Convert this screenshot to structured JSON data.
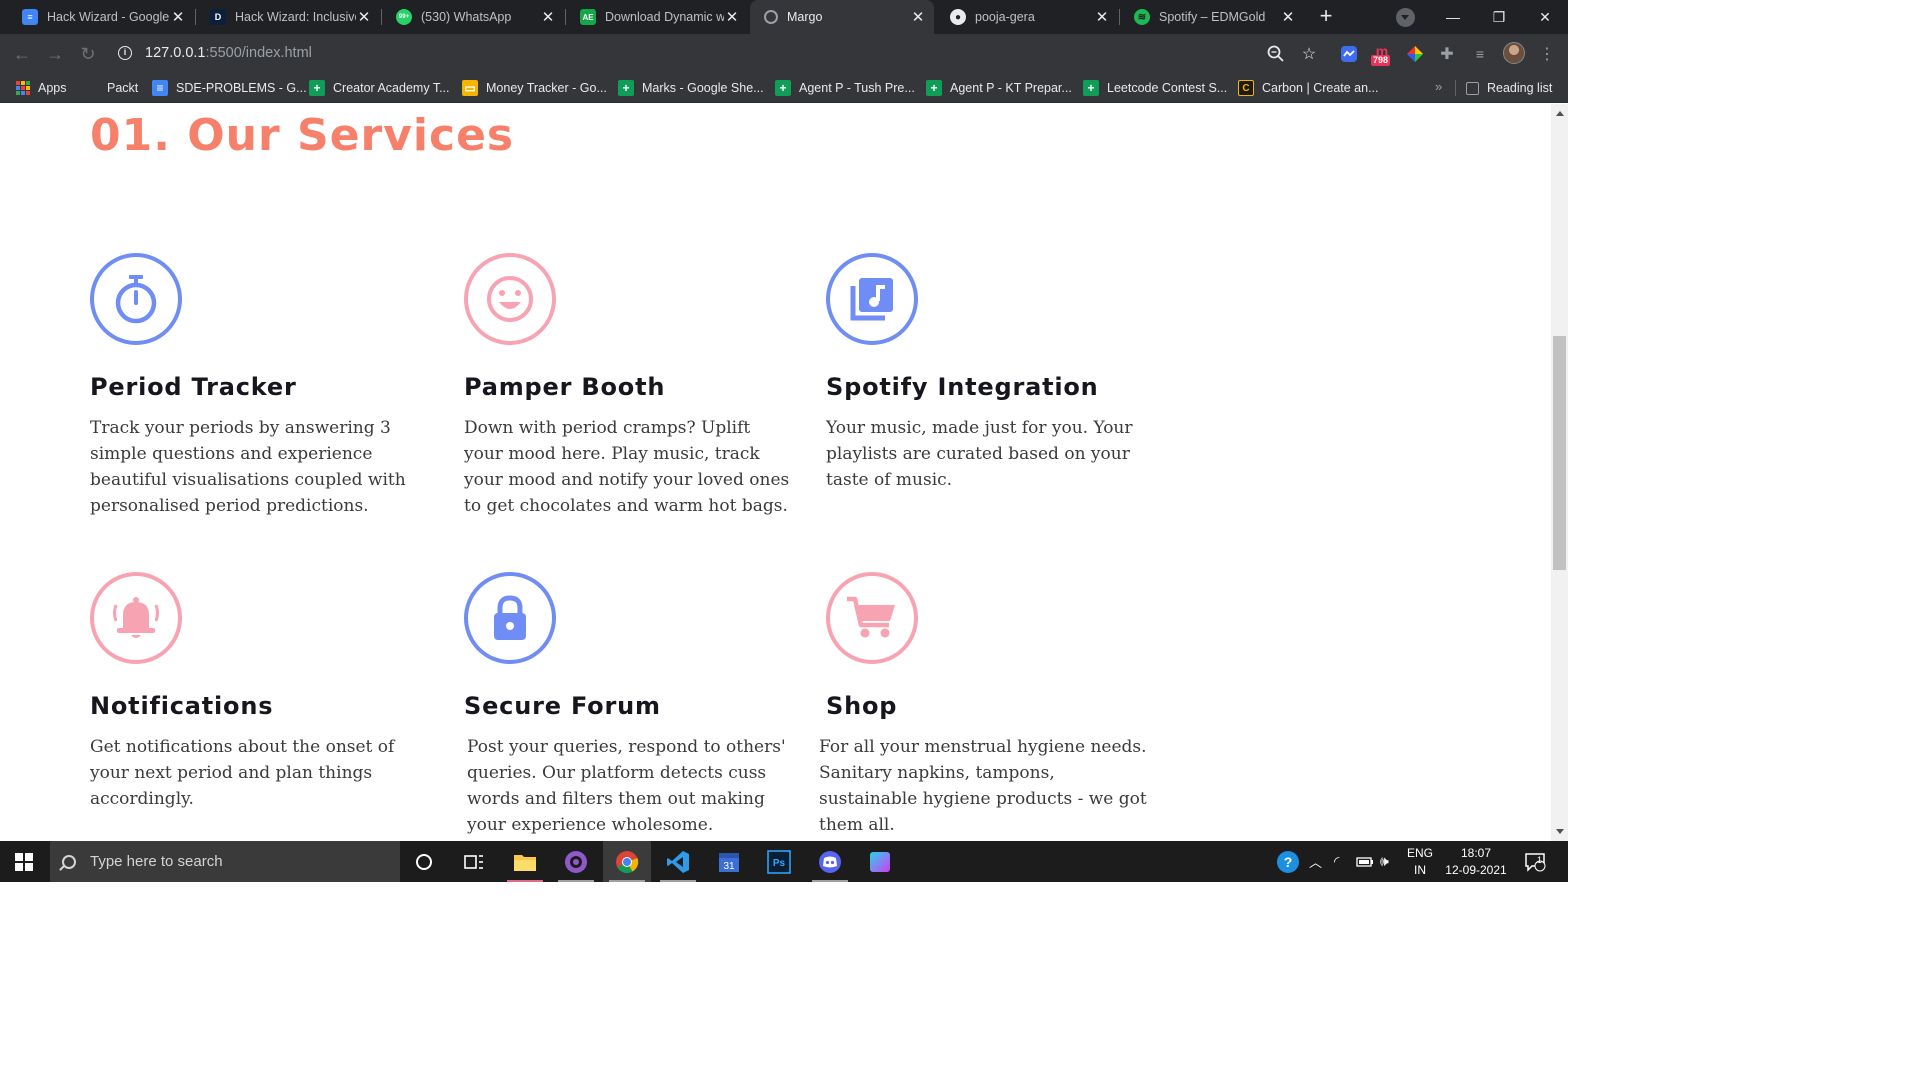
{
  "browser": {
    "tabs": [
      {
        "title": "Hack Wizard - Google",
        "favicon_color": "#4285f4",
        "favicon_text": "≡"
      },
      {
        "title": "Hack Wizard: Inclusive",
        "favicon_color": "#0d1f3c",
        "favicon_text": "D"
      },
      {
        "title": "(530) WhatsApp",
        "favicon_color": "#25d366",
        "favicon_text": "99+"
      },
      {
        "title": "Download Dynamic w",
        "favicon_color": "#14a84a",
        "favicon_text": "AE"
      },
      {
        "title": "Margo",
        "favicon_color": "#9aa0a6",
        "favicon_text": "◍"
      },
      {
        "title": "pooja-gera",
        "favicon_color": "#202124",
        "favicon_text": "●"
      },
      {
        "title": "Spotify – EDMGold",
        "favicon_color": "#1db954",
        "favicon_text": "≋"
      }
    ],
    "active_tab_index": 4,
    "new_tab_label": "+",
    "window_controls": {
      "minimize": "—",
      "maximize": "❐",
      "close": "✕"
    },
    "url_host": "127.0.0.1",
    "url_path": ":5500/index.html",
    "extension_badge": "798",
    "bookmarks": [
      {
        "label": "Apps",
        "icon": "apps-grid-icon",
        "color": "#4285f4"
      },
      {
        "label": "Packt",
        "icon": "none",
        "color": ""
      },
      {
        "label": "SDE-PROBLEMS - G...",
        "icon": "docs-icon",
        "color": "#4285f4"
      },
      {
        "label": "Creator Academy T...",
        "icon": "sheets-icon",
        "color": "#0f9d58"
      },
      {
        "label": "Money Tracker - Go...",
        "icon": "slides-icon",
        "color": "#f4b400"
      },
      {
        "label": "Marks - Google She...",
        "icon": "sheets-icon",
        "color": "#0f9d58"
      },
      {
        "label": "Agent P - Tush Pre...",
        "icon": "sheets-icon",
        "color": "#0f9d58"
      },
      {
        "label": "Agent P - KT Prepar...",
        "icon": "sheets-icon",
        "color": "#0f9d58"
      },
      {
        "label": "Leetcode Contest S...",
        "icon": "sheets-icon",
        "color": "#0f9d58"
      },
      {
        "label": "Carbon | Create an...",
        "icon": "carbon-icon",
        "color": "#1b1b1b"
      }
    ],
    "bookmarks_more": "»",
    "reading_list": "Reading list"
  },
  "page": {
    "section_title": "01. Our Services",
    "colors": {
      "accent": "#f6806a",
      "blue": "#6f8df5",
      "pink": "#f7a3b2"
    },
    "services": [
      {
        "title": "Period Tracker",
        "description": "Track your periods by answering 3 simple questions and experience beautiful visualisations coupled with personalised period predictions.",
        "icon": "stopwatch-icon",
        "theme": "blue"
      },
      {
        "title": "Pamper Booth",
        "description": "Down with period cramps? Uplift your mood here. Play music, track your mood and notify your loved ones to get chocolates and warm hot bags.",
        "icon": "smiley-icon",
        "theme": "pink"
      },
      {
        "title": "Spotify Integration",
        "description": "Your music, made just for you. Your playlists are curated based on your taste of music.",
        "icon": "music-library-icon",
        "theme": "blue"
      },
      {
        "title": "Notifications",
        "description": "Get notifications about the onset of your next period and plan things accordingly.",
        "icon": "bell-icon",
        "theme": "pink"
      },
      {
        "title": "Secure Forum",
        "description": "Post your queries, respond to others' queries. Our platform detects cuss words and filters them out making your experience wholesome.",
        "icon": "lock-icon",
        "theme": "blue"
      },
      {
        "title": "Shop",
        "description": "For all your menstrual hygiene needs. Sanitary napkins, tampons, sustainable hygiene products - we got them all.",
        "icon": "shopping-cart-icon",
        "theme": "pink"
      }
    ]
  },
  "taskbar": {
    "search_placeholder": "Type here to search",
    "language": "ENG",
    "region": "IN",
    "time": "18:07",
    "date": "12-09-2021",
    "notification_count": "1"
  }
}
